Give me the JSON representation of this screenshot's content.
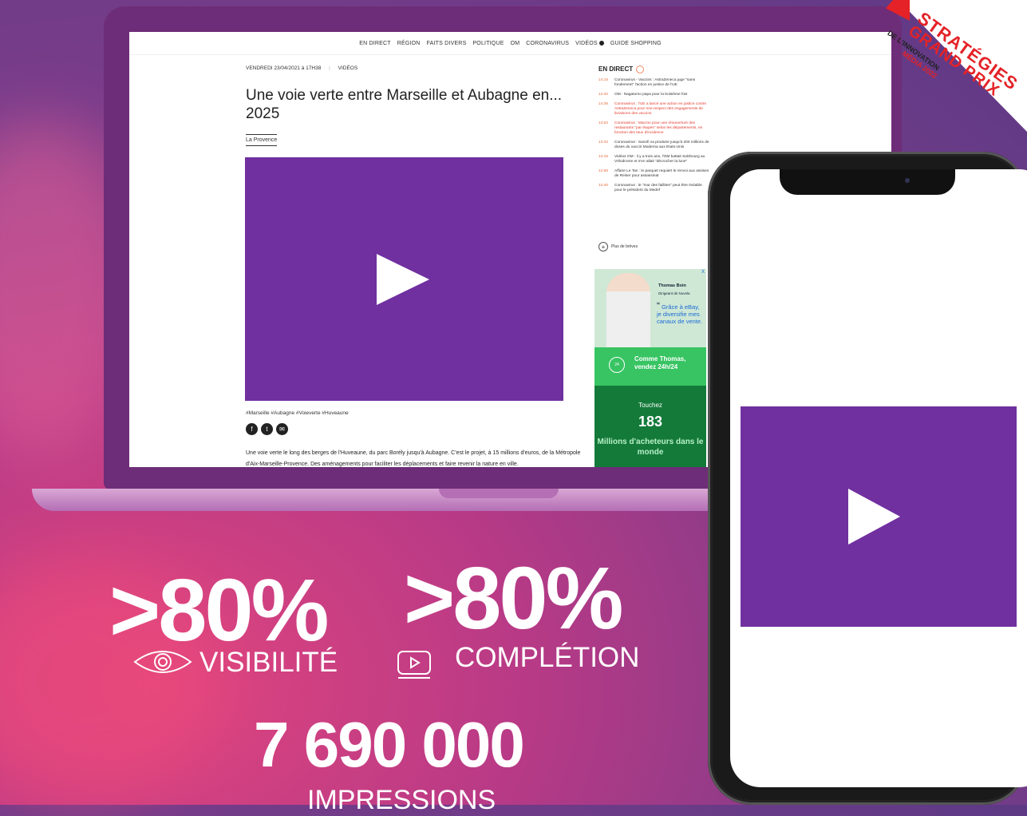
{
  "nav": {
    "items": [
      "EN DIRECT",
      "RÉGION",
      "FAITS DIVERS",
      "POLITIQUE",
      "OM",
      "CORONAVIRUS",
      "VIDÉOS",
      "GUIDE SHOPPING"
    ]
  },
  "article": {
    "meta": "VENDREDI 23/04/2021 à 17H38",
    "category": "VIDÉOS",
    "title": "Une voie verte entre Marseille et Aubagne en... 2025",
    "source": "La Provence",
    "tags": "#Marseille #Aubagne #Voieverte #Huveaune",
    "body": "Une voie verte le long des berges de l'Huveaune, du parc Borély jusqu'à Aubagne. C'est le projet, à 15 millions d'euros, de la Métropole d'Aix-Marseille-Provence. Des aménagements pour faciliter les déplacements et faire revenir la nature en ville."
  },
  "live": {
    "title": "EN DIRECT",
    "items": [
      {
        "time": "14:15",
        "text": "Coronavirus - Vaccins : AstraZeneca juge \"sans fondement\" l'action en justice de l'UE",
        "red": false
      },
      {
        "time": "14:40",
        "text": "OM : Nagatomo papa pour la troisième fois",
        "red": false
      },
      {
        "time": "14:36",
        "text": "Coronavirus : l'UE a lancé une action en justice contre AstraZeneca pour non-respect des engagements de livraisons des vaccins",
        "red": true
      },
      {
        "time": "13:52",
        "text": "Coronavirus : Macron pour une réouverture des restaurants \"par étapes\" selon les départements, en fonction des taux d'incidence",
        "red": true
      },
      {
        "time": "13:32",
        "text": "Coronavirus : Sanofi va produire jusqu'à 200 millions de doses du vaccin Moderna aux Etats-Unis",
        "red": false
      },
      {
        "time": "13:15",
        "text": "Vidéos OM : il y a trois ans, l'OM battait Salzbourg au Vélodrome et s'en allait \"décrocher la lune\"",
        "red": false
      },
      {
        "time": "12:56",
        "text": "Affaire Le Tan : le parquet requiert le renvoi aux assises de Reiser pour assassinat",
        "red": false
      },
      {
        "time": "12:40",
        "text": "Coronavirus : le \"mur des faillites\" peut être évitable pour le président du Medef",
        "red": false
      }
    ],
    "more": "Plus de brèves"
  },
  "ad": {
    "name": "Thomas Boin",
    "role": "Dirigeant de Novela",
    "quote": "Grâce à eBay, je diversifie mes canaux de vente.",
    "clock": "24",
    "mid": "Comme Thomas, vendez 24h/24",
    "b1": "Touchez",
    "b2": "183",
    "b3": "Millions d'acheteurs dans le monde",
    "close": "X"
  },
  "badge": {
    "l1": "STRATÉGIES",
    "l2": "GRAND PRIX",
    "l3": "DE L'INNOVATION",
    "l4": "MÉDIA 2022"
  },
  "stats": {
    "visibility_value": ">80%",
    "visibility_label": "VISIBILITÉ",
    "completion_value": ">80%",
    "completion_label": "COMPLÉTION",
    "impressions_value": "7 690 000",
    "impressions_label": "IMPRESSIONS"
  },
  "colors": {
    "video_purple": "#7030a0",
    "badge_red": "#e42227",
    "ad_green": "#38c463",
    "ad_dark_green": "#147a3a"
  },
  "icons": {
    "eye": "eye-icon",
    "youtube": "play-box-icon",
    "play": "play-triangle-icon"
  }
}
